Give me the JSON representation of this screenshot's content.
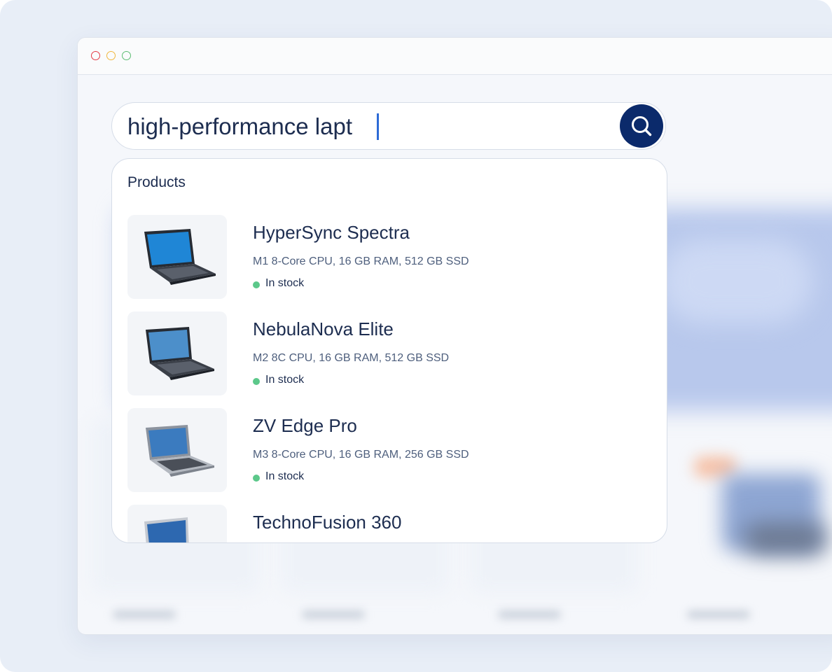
{
  "window": {
    "controls": {
      "close": "#e33a44",
      "minimize": "#f0b73d",
      "maximize": "#5cbd72"
    }
  },
  "search": {
    "value": "high-performance lapt",
    "placeholder": "",
    "button_icon": "search-icon",
    "button_color": "#0b2a6b"
  },
  "dropdown": {
    "section_title": "Products",
    "results": [
      {
        "name": "HyperSync Spectra",
        "specs": "M1 8-Core CPU, 16 GB RAM, 512 GB SSD",
        "status": "In stock",
        "image_icon": "laptop-icon",
        "screen_color": "#1f86d6"
      },
      {
        "name": "NebulaNova Elite",
        "specs": "M2 8C CPU, 16 GB RAM, 512 GB SSD",
        "status": "In stock",
        "image_icon": "laptop-icon",
        "screen_color": "#4c8fca"
      },
      {
        "name": "ZV Edge Pro",
        "specs": "M3 8-Core CPU, 16 GB RAM, 256 GB SSD",
        "status": "In stock",
        "image_icon": "laptop-icon",
        "screen_color": "#3b7bbf"
      },
      {
        "name": "TechnoFusion 360",
        "specs": "",
        "status": "",
        "image_icon": "laptop-icon",
        "screen_color": "#2d68b0"
      }
    ]
  },
  "colors": {
    "text_primary": "#1d2d50",
    "text_secondary": "#4e5f7d",
    "in_stock": "#5cc88a",
    "caret": "#2d6bd6"
  }
}
